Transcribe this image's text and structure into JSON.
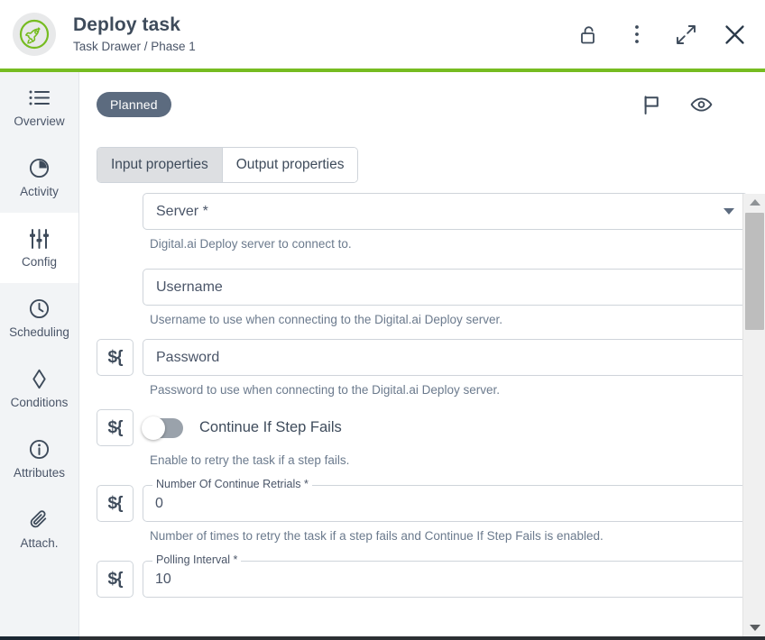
{
  "header": {
    "logo_icon": "rocket-icon",
    "title": "Deploy task",
    "breadcrumb": "Task Drawer / Phase 1",
    "actions": [
      {
        "name": "unlock-icon",
        "label": "Unlock"
      },
      {
        "name": "more-vertical-icon",
        "label": "More options"
      },
      {
        "name": "expand-icon",
        "label": "Expand"
      },
      {
        "name": "close-icon",
        "label": "Close"
      }
    ],
    "accent_color": "#76bc21"
  },
  "sidebar": {
    "items": [
      {
        "label": "Overview",
        "icon": "list-icon",
        "selected": false
      },
      {
        "label": "Activity",
        "icon": "pie-clock-icon",
        "selected": false
      },
      {
        "label": "Config",
        "icon": "sliders-icon",
        "selected": true
      },
      {
        "label": "Scheduling",
        "icon": "clock-icon",
        "selected": false
      },
      {
        "label": "Conditions",
        "icon": "diamond-icon",
        "selected": false
      },
      {
        "label": "Attributes",
        "icon": "info-circle-icon",
        "selected": false
      },
      {
        "label": "Attach.",
        "icon": "paperclip-icon",
        "selected": false
      }
    ]
  },
  "main": {
    "status_badge": "Planned",
    "status_badge_color": "#5c6b7f",
    "status_actions": [
      {
        "name": "flag-icon",
        "label": "Flag"
      },
      {
        "name": "eye-icon",
        "label": "Watch"
      }
    ],
    "tabs": [
      {
        "label": "Input properties",
        "active": true
      },
      {
        "label": "Output properties",
        "active": false
      }
    ],
    "variable_button_label": "${",
    "fields": [
      {
        "id": "server",
        "type": "select",
        "label": "Server *",
        "value": "Server *",
        "helper": "Digital.ai Deploy server to connect to.",
        "has_variable_button": false
      },
      {
        "id": "username",
        "type": "text",
        "label": "Username",
        "value": "Username",
        "helper": "Username to use when connecting to the Digital.ai Deploy server.",
        "has_variable_button": false
      },
      {
        "id": "password",
        "type": "text",
        "label": "Password",
        "value": "Password",
        "helper": "Password to use when connecting to the Digital.ai Deploy server.",
        "has_variable_button": true
      },
      {
        "id": "continue-if-step-fails",
        "type": "toggle",
        "label": "Continue If Step Fails",
        "value": "off",
        "helper": "Enable to retry the task if a step fails.",
        "has_variable_button": true
      },
      {
        "id": "number-of-continue-retrials",
        "type": "outlined",
        "label": "Number Of Continue Retrials *",
        "value": "0",
        "helper": "Number of times to retry the task if a step fails and Continue If Step Fails is enabled.",
        "has_variable_button": true
      },
      {
        "id": "polling-interval",
        "type": "outlined",
        "label": "Polling Interval *",
        "value": "10",
        "helper": "",
        "has_variable_button": true
      }
    ]
  },
  "scrollbar": {
    "up_arrow": "scroll-up-icon",
    "down_arrow": "scroll-down-icon",
    "thumb": "scroll-thumb"
  }
}
